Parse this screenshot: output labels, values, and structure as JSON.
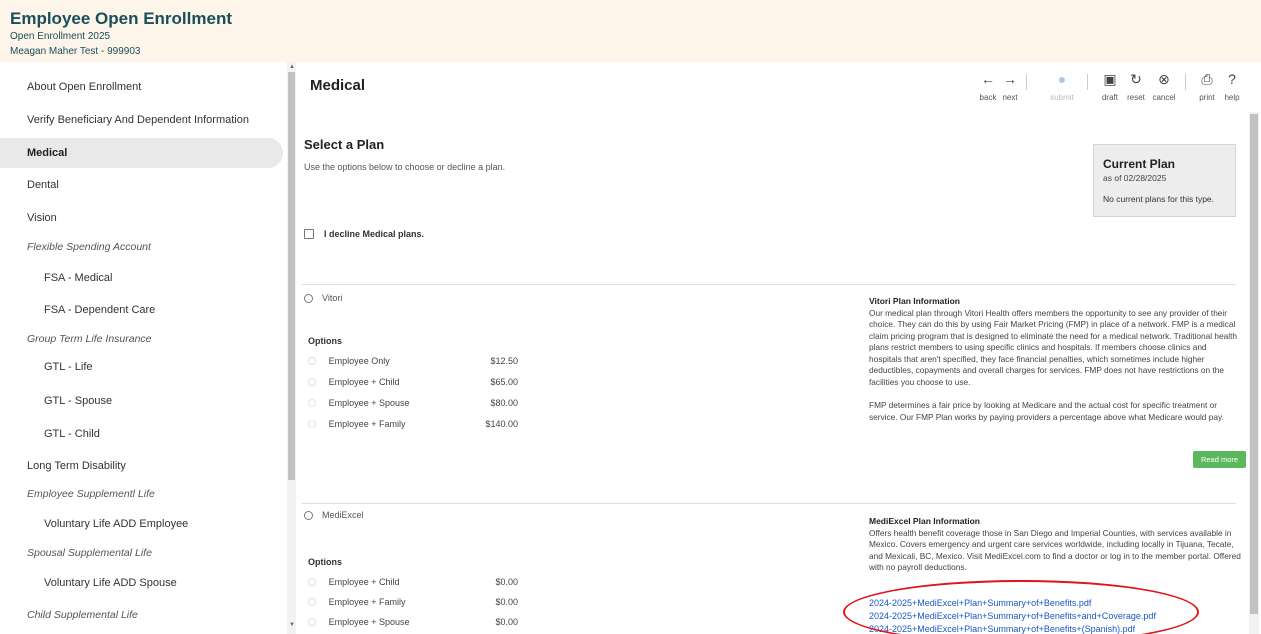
{
  "header": {
    "title": "Employee Open Enrollment",
    "subtitle": "Open Enrollment 2025",
    "user": "Meagan Maher Test - 999903"
  },
  "sidebar": {
    "items": [
      {
        "label": "About Open Enrollment",
        "type": "item"
      },
      {
        "label": "Verify Beneficiary And Dependent Information",
        "type": "item"
      },
      {
        "label": "Medical",
        "type": "item",
        "active": true
      },
      {
        "label": "Dental",
        "type": "item"
      },
      {
        "label": "Vision",
        "type": "item"
      },
      {
        "label": "Flexible Spending Account",
        "type": "section"
      },
      {
        "label": "FSA - Medical",
        "type": "subitem"
      },
      {
        "label": "FSA - Dependent Care",
        "type": "subitem"
      },
      {
        "label": "Group Term Life Insurance",
        "type": "section"
      },
      {
        "label": "GTL - Life",
        "type": "subitem"
      },
      {
        "label": "GTL - Spouse",
        "type": "subitem"
      },
      {
        "label": "GTL - Child",
        "type": "subitem"
      },
      {
        "label": "Long Term Disability",
        "type": "item"
      },
      {
        "label": "Employee Supplementl Life",
        "type": "section"
      },
      {
        "label": "Voluntary Life ADD Employee",
        "type": "subitem"
      },
      {
        "label": "Spousal Supplemental Life",
        "type": "section"
      },
      {
        "label": "Voluntary Life ADD Spouse",
        "type": "subitem"
      },
      {
        "label": "Child Supplemental Life",
        "type": "section"
      }
    ]
  },
  "main": {
    "page_title": "Medical",
    "toolbar": {
      "back": {
        "label": "back",
        "icon": "arrow-left-icon"
      },
      "next": {
        "label": "next",
        "icon": "arrow-right-icon"
      },
      "submit": {
        "label": "submit",
        "icon": "check-circle-icon",
        "disabled": true
      },
      "draft": {
        "label": "draft",
        "icon": "save-icon"
      },
      "reset": {
        "label": "reset",
        "icon": "reset-icon"
      },
      "cancel": {
        "label": "cancel",
        "icon": "cancel-icon"
      },
      "print": {
        "label": "print",
        "icon": "print-icon"
      },
      "help": {
        "label": "help",
        "icon": "help-icon"
      }
    },
    "select_title": "Select a Plan",
    "select_desc": "Use the options below to choose or decline a plan.",
    "decline_label": "I decline Medical plans.",
    "current_plan": {
      "title": "Current Plan",
      "as_of": "as of 02/28/2025",
      "none": "No current plans for this type."
    },
    "plans": [
      {
        "name": "Vitori",
        "options_label": "Options",
        "options": [
          {
            "name": "Employee Only",
            "price": "$12.50"
          },
          {
            "name": "Employee + Child",
            "price": "$65.00"
          },
          {
            "name": "Employee + Spouse",
            "price": "$80.00"
          },
          {
            "name": "Employee + Family",
            "price": "$140.00"
          }
        ],
        "info_title": "Vitori Plan Information",
        "info_p1": "Our medical plan through Vitori Health offers members the opportunity to see any provider of their choice. They can do this by using Fair Market Pricing (FMP) in place of a network. FMP is a medical claim pricing program that is designed to eliminate the need for a medical network. Traditional health plans restrict members to using specific clinics and hospitals. If members choose clinics and hospitals that aren't specified, they face financial penalties, which sometimes include higher deductibles, copayments and overall charges for services. FMP does not have restrictions on the facilities you choose to use.",
        "info_p2": "FMP determines a fair price by looking at Medicare and the actual cost for specific treatment or service. Our FMP Plan works by paying providers a percentage above what Medicare would pay.",
        "read_more": "Read more"
      },
      {
        "name": "MediExcel",
        "options_label": "Options",
        "options": [
          {
            "name": "Employee + Child",
            "price": "$0.00"
          },
          {
            "name": "Employee + Family",
            "price": "$0.00"
          },
          {
            "name": "Employee + Spouse",
            "price": "$0.00"
          }
        ],
        "info_title": "MediExcel Plan Information",
        "info_p1": "Offers health benefit coverage those in San Diego and Imperial Counties, with services available in Mexico. Covers emergency and urgent care services worldwide, including locally in Tijuana, Tecate, and Mexicali, BC, Mexico. Visit MediExcel.com to find a doctor or log in to the member portal. Offered with no payroll deductions.",
        "links": [
          "2024-2025+MediExcel+Plan+Summary+of+Benefits.pdf",
          "2024-2025+MediExcel+Plan+Summary+of+Benefits+and+Coverage.pdf",
          "2024-2025+MediExcel+Plan+Summary+of+Benefits+(Spanish).pdf"
        ]
      }
    ]
  }
}
